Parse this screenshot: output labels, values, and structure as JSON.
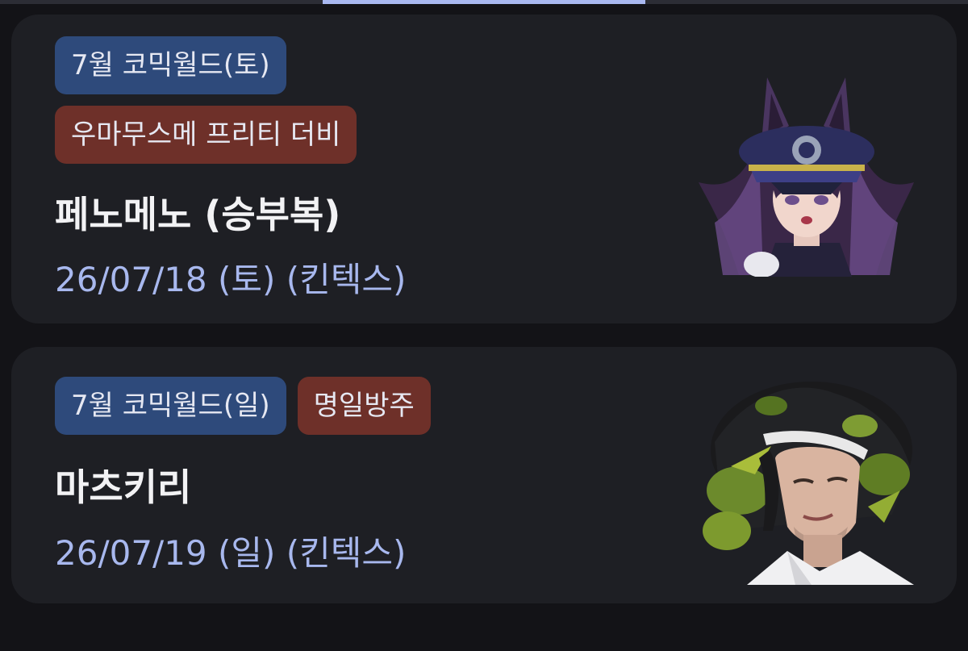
{
  "items": [
    {
      "event_tag": "7월 코믹월드(토)",
      "series_tag": "우마무스메 프리티 더비",
      "title": "페노메노 (승부복)",
      "date": "26/07/18 (토) (킨텍스)",
      "thumbnail": "character-portrait-horse-girl",
      "colors": {
        "event_tag_bg": "#2e4a7b",
        "series_tag_bg": "#6e3029"
      }
    },
    {
      "event_tag": "7월 코믹월드(일)",
      "series_tag": "명일방주",
      "title": "마츠키리",
      "date": "26/07/19 (일) (킨텍스)",
      "thumbnail": "character-portrait-man-leaf-crown",
      "colors": {
        "event_tag_bg": "#2e4a7b",
        "series_tag_bg": "#6e3029"
      }
    }
  ],
  "theme": {
    "background": "#131317",
    "card_background": "#1e1f24",
    "accent": "#a9b8f0",
    "date_text": "#a8b8ee"
  }
}
